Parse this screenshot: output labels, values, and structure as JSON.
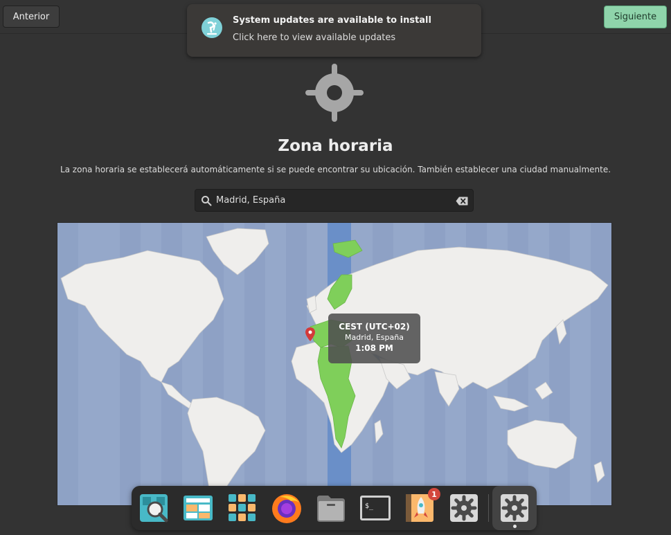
{
  "header": {
    "back_label": "Anterior",
    "next_label": "Siguiente"
  },
  "notification": {
    "title": "System updates are available to install",
    "body": "Click here to view available updates",
    "icon": "pop-os-icon"
  },
  "page": {
    "icon": "location-crosshair-icon",
    "title": "Zona horaria",
    "description": "La zona horaria se establecerá automáticamente si se puede encontrar su ubicación. También establecer una ciudad manualmente."
  },
  "search": {
    "value": "Madrid, España",
    "icon": "search-icon",
    "clear_icon": "clear-text-icon"
  },
  "map": {
    "selected_zone": "CEST (UTC+02)",
    "selected_city": "Madrid, España",
    "selected_time": "1:08 PM",
    "colors": {
      "ocean": "#95a8ca",
      "land": "#efeeec",
      "highlight": "#7fcf5a",
      "band": "#6a8fc8"
    }
  },
  "dock": {
    "items": [
      {
        "name": "launcher",
        "icon": "search-magnifier-icon"
      },
      {
        "name": "workspaces",
        "icon": "workspaces-icon"
      },
      {
        "name": "applications",
        "icon": "app-grid-icon"
      },
      {
        "name": "firefox",
        "icon": "firefox-icon"
      },
      {
        "name": "files",
        "icon": "file-manager-icon"
      },
      {
        "name": "terminal",
        "icon": "terminal-icon",
        "prompt": "$_"
      },
      {
        "name": "pop-shop",
        "icon": "shop-rocket-icon",
        "badge": "1"
      },
      {
        "name": "settings",
        "icon": "settings-gear-icon"
      },
      {
        "name": "initial-setup",
        "icon": "settings-gear-icon",
        "active": true
      }
    ]
  }
}
